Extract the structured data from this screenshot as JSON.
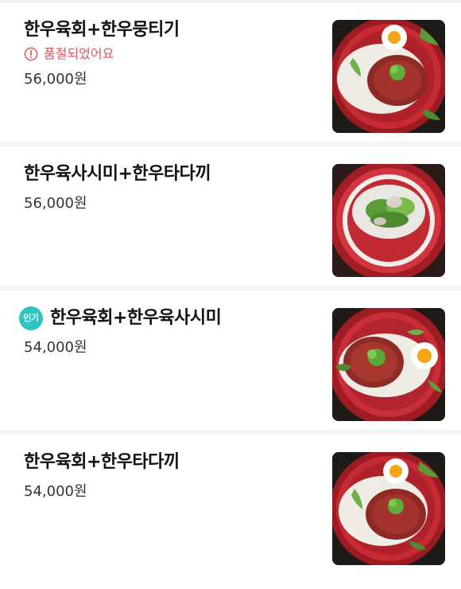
{
  "menu": {
    "items": [
      {
        "name": "한우육회+한우뭉티기",
        "soldout_label": "품절되었어요",
        "price": "56,000원",
        "photo": "raw-beef-platter-with-egg-yolk"
      },
      {
        "name": "한우육사시미+한우타다끼",
        "price": "56,000원",
        "photo": "beef-sashimi-platter-with-greens"
      },
      {
        "badge": "인기",
        "name": "한우육회+한우육사시미",
        "price": "54,000원",
        "photo": "raw-beef-platter-with-egg-yolk"
      },
      {
        "name": "한우육회+한우타다끼",
        "price": "54,000원",
        "photo": "raw-beef-platter-with-egg-yolk"
      }
    ]
  },
  "colors": {
    "soldout": "#e8525a",
    "badge": "#2ec4c1",
    "divider": "#f4f4f4"
  },
  "icons": {
    "soldout": "alert-circle-icon"
  }
}
